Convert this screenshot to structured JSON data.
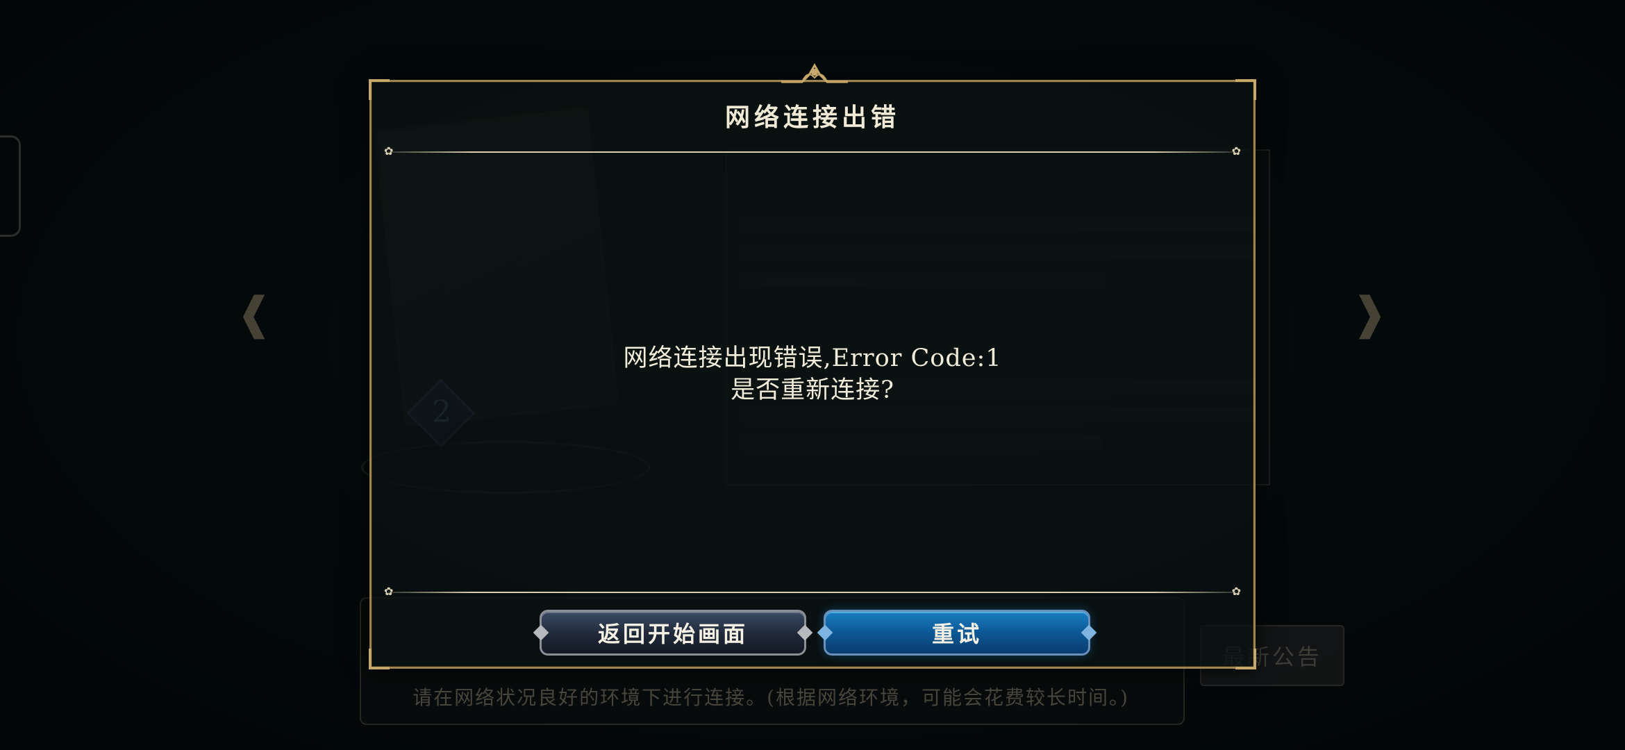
{
  "dialog": {
    "title": "网络连接出错",
    "message_line1": "网络连接出现错误,Error Code:1",
    "message_line2": "是否重新连接?",
    "back_button": "返回开始画面",
    "retry_button": "重试"
  },
  "background": {
    "card_cost": "2",
    "bottom_tip": "请在网络状况良好的环境下进行连接。(根据网络环境，可能会花费较长时间。)",
    "news_button": "最新公告"
  },
  "colors": {
    "frame_gold": "#9d8450",
    "retry_blue": "#0d5b9a",
    "back_slate": "#1f2838"
  },
  "icons": {
    "left_arrow": "left-arrow-icon",
    "right_arrow": "right-arrow-icon",
    "crest": "crest-ornament-icon"
  }
}
